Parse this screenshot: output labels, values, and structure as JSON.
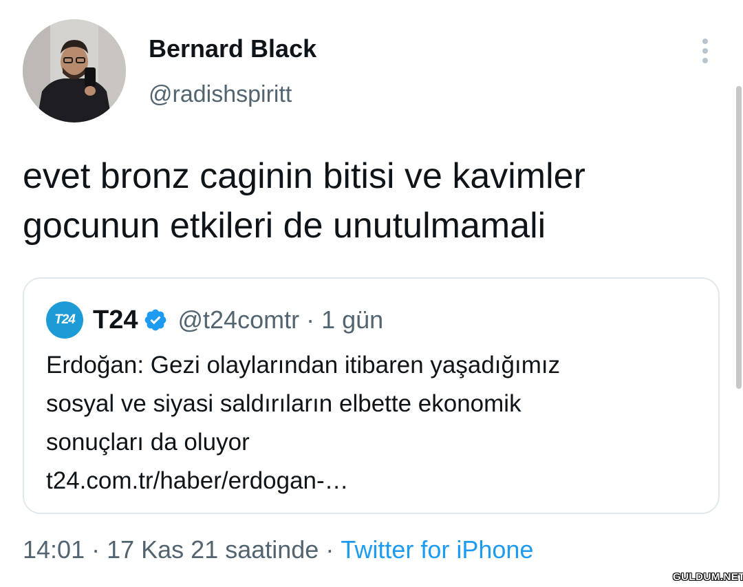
{
  "author": {
    "display_name": "Bernard Black",
    "handle": "@radishspiritt"
  },
  "tweet": {
    "text": "evet bronz caginin bitisi ve kavimler\ngocunun etkileri de unutulmamali"
  },
  "quoted_tweet": {
    "logo_text": "T24",
    "name": "T24",
    "handle": "@t24comtr",
    "separator": "·",
    "time": "1 gün",
    "text": "Erdoğan: Gezi olaylarından itibaren yaşadığımız\nsosyal ve siyasi saldırıların elbette ekonomik\nsonuçları da oluyor\nt24.com.tr/haber/erdogan-…"
  },
  "meta": {
    "time": "14:01",
    "separator": "·",
    "date": "17 Kas 21 saatinde",
    "source": "Twitter for iPhone"
  },
  "watermark": "GULDUM.NET",
  "icons": {
    "more": "more-vertical-icon",
    "verified": "verified-badge-icon"
  },
  "colors": {
    "text": "#0f1419",
    "muted": "#536471",
    "accent": "#1d9bf0",
    "border": "#e1e8ed",
    "t24_logo": "#1d9bd7"
  }
}
